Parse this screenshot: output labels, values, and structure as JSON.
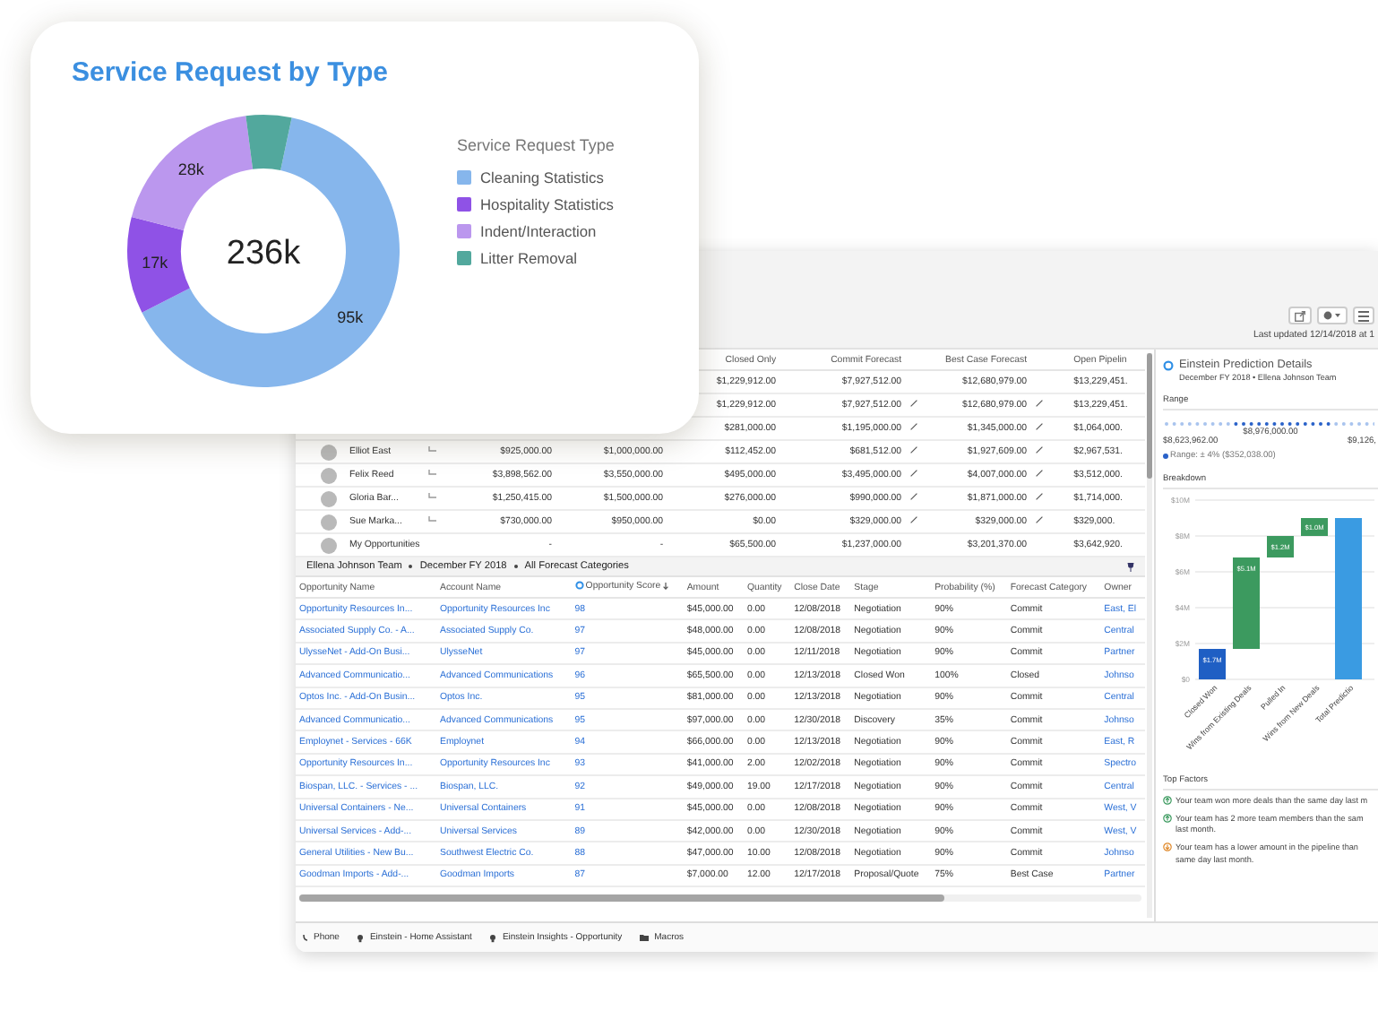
{
  "card": {
    "title": "Service Request by Type",
    "center_label": "236k",
    "chart_data": {
      "type": "donut",
      "categories": [
        "Cleaning Statistics",
        "Hospitality Statistics",
        "Indent/Interaction",
        "Litter Removal"
      ],
      "colors": [
        "#86b6ec",
        "#8f52e6",
        "#bb97ee",
        "#52a89d"
      ],
      "legend_title": "Service Request Type",
      "series": [
        {
          "values": [
            64.2,
            11.5,
            18.9,
            5.4
          ]
        }
      ],
      "value_labels": [
        "95k",
        "17k",
        "28k",
        null
      ]
    }
  },
  "app": {
    "last_updated": "Last updated 12/14/2018 at 1",
    "forecast_table": {
      "columns": [
        "Closed Only",
        "Commit Forecast",
        "Best Case Forecast",
        "Open Pipelin"
      ],
      "rows": [
        {
          "editable": false,
          "closed": "$1,229,912.00",
          "commit": "$7,927,512.00",
          "best": "$12,680,979.00",
          "open": "$13,229,451."
        },
        {
          "editable": true,
          "closed": "$1,229,912.00",
          "commit": "$7,927,512.00",
          "best": "$12,680,979.00",
          "open": "$13,229,451."
        },
        {
          "editable": true,
          "closed": "$281,000.00",
          "commit": "$1,195,000.00",
          "best": "$1,345,000.00",
          "open": "$1,064,000."
        },
        {
          "kind": "member",
          "name": "Elliot East",
          "amount_1": "$925,000.00",
          "amount_2": "$1,000,000.00",
          "editable": true,
          "closed": "$112,452.00",
          "commit": "$681,512.00",
          "best": "$1,927,609.00",
          "open": "$2,967,531."
        },
        {
          "kind": "member",
          "name": "Felix Reed",
          "amount_1": "$3,898,562.00",
          "amount_2": "$3,550,000.00",
          "editable": true,
          "closed": "$495,000.00",
          "commit": "$3,495,000.00",
          "best": "$4,007,000.00",
          "open": "$3,512,000."
        },
        {
          "kind": "member",
          "name": "Gloria Bar...",
          "amount_1": "$1,250,415.00",
          "amount_2": "$1,500,000.00",
          "editable": true,
          "closed": "$276,000.00",
          "commit": "$990,000.00",
          "best": "$1,871,000.00",
          "open": "$1,714,000."
        },
        {
          "kind": "member",
          "name": "Sue Marka...",
          "amount_1": "$730,000.00",
          "amount_2": "$950,000.00",
          "editable": true,
          "closed": "$0.00",
          "commit": "$329,000.00",
          "best": "$329,000.00",
          "open": "$329,000."
        },
        {
          "kind": "self",
          "name": "My Opportunities",
          "amount_1": "-",
          "amount_2": "-",
          "editable": false,
          "closed": "$65,500.00",
          "commit": "$1,237,000.00",
          "best": "$3,201,370.00",
          "open": "$3,642,920."
        }
      ]
    },
    "opportunities": {
      "breadcrumb": [
        "Ellena Johnson Team",
        "December FY 2018",
        "All Forecast Categories"
      ],
      "columns": [
        {
          "label": "Opportunity Name",
          "sorted": false
        },
        {
          "label": "Account Name",
          "sorted": false
        },
        {
          "label": "Opportunity Score",
          "sorted": true
        },
        {
          "label": "Amount",
          "sorted": false
        },
        {
          "label": "Quantity",
          "sorted": false
        },
        {
          "label": "Close Date",
          "sorted": false
        },
        {
          "label": "Stage",
          "sorted": false
        },
        {
          "label": "Probability (%)",
          "sorted": false
        },
        {
          "label": "Forecast Category",
          "sorted": false
        },
        {
          "label": "Owner",
          "sorted": false
        }
      ],
      "rows": [
        [
          "Opportunity Resources In...",
          "Opportunity Resources Inc",
          "98",
          "$45,000.00",
          "0.00",
          "12/08/2018",
          "Negotiation",
          "90%",
          "Commit",
          "East, El"
        ],
        [
          "Associated Supply Co. - A...",
          "Associated Supply Co.",
          "97",
          "$48,000.00",
          "0.00",
          "12/08/2018",
          "Negotiation",
          "90%",
          "Commit",
          "Central"
        ],
        [
          "UlysseNet - Add-On Busi...",
          "UlysseNet",
          "97",
          "$45,000.00",
          "0.00",
          "12/11/2018",
          "Negotiation",
          "90%",
          "Commit",
          "Partner"
        ],
        [
          "Advanced Communicatio...",
          "Advanced Communications",
          "96",
          "$65,500.00",
          "0.00",
          "12/13/2018",
          "Closed Won",
          "100%",
          "Closed",
          "Johnso"
        ],
        [
          "Optos Inc. - Add-On Busin...",
          "Optos Inc.",
          "95",
          "$81,000.00",
          "0.00",
          "12/13/2018",
          "Negotiation",
          "90%",
          "Commit",
          "Central"
        ],
        [
          "Advanced Communicatio...",
          "Advanced Communications",
          "95",
          "$97,000.00",
          "0.00",
          "12/30/2018",
          "Discovery",
          "35%",
          "Commit",
          "Johnso"
        ],
        [
          "Employnet - Services - 66K",
          "Employnet",
          "94",
          "$66,000.00",
          "0.00",
          "12/13/2018",
          "Negotiation",
          "90%",
          "Commit",
          "East, R"
        ],
        [
          "Opportunity Resources In...",
          "Opportunity Resources Inc",
          "93",
          "$41,000.00",
          "2.00",
          "12/02/2018",
          "Negotiation",
          "90%",
          "Commit",
          "Spectro"
        ],
        [
          "Biospan, LLC. - Services - ...",
          "Biospan, LLC.",
          "92",
          "$49,000.00",
          "19.00",
          "12/17/2018",
          "Negotiation",
          "90%",
          "Commit",
          "Central"
        ],
        [
          "Universal Containers - Ne...",
          "Universal Containers",
          "91",
          "$45,000.00",
          "0.00",
          "12/08/2018",
          "Negotiation",
          "90%",
          "Commit",
          "West, V"
        ],
        [
          "Universal Services - Add-...",
          "Universal Services",
          "89",
          "$42,000.00",
          "0.00",
          "12/30/2018",
          "Negotiation",
          "90%",
          "Commit",
          "West, V"
        ],
        [
          "General Utilities - New Bu...",
          "Southwest Electric Co.",
          "88",
          "$47,000.00",
          "10.00",
          "12/08/2018",
          "Negotiation",
          "90%",
          "Commit",
          "Johnso"
        ],
        [
          "Goodman Imports - Add-...",
          "Goodman Imports",
          "87",
          "$7,000.00",
          "12.00",
          "12/17/2018",
          "Proposal/Quote",
          "75%",
          "Best Case",
          "Partner"
        ]
      ]
    },
    "prediction": {
      "title": "Einstein Prediction Details",
      "subtitle": "December FY 2018 • Ellena Johnson Team",
      "range_label": "Range",
      "predicted": "$8,976,000.00",
      "range_low": "$8,623,962.00",
      "range_high": "$9,126,",
      "range_note": "Range: ± 4% ($352,038.00)",
      "breakdown_label": "Breakdown",
      "chart_data": {
        "type": "candlestick",
        "grid": true,
        "categories": [
          "Closed Won",
          "Wins from Existing Deals",
          "Pulled In",
          "Wins from New Deals",
          "Total Predictio"
        ],
        "colors": [
          "#1f5fc4",
          "#3c9a5f",
          "#3c9a5f",
          "#3c9a5f",
          "#3a9be2"
        ],
        "ohlc": [
          [
            0,
            1.7,
            0,
            1.7
          ],
          [
            1.7,
            6.8,
            1.7,
            6.8
          ],
          [
            6.8,
            8.0,
            6.8,
            8.0
          ],
          [
            8.0,
            9.0,
            8.0,
            9.0
          ],
          [
            0,
            9.0,
            0,
            9.0
          ]
        ],
        "ylim": [
          0,
          10
        ],
        "yticks": [
          {
            "value": 0,
            "label": "$0"
          },
          {
            "value": 2,
            "label": "$2M"
          },
          {
            "value": 4,
            "label": "$4M"
          },
          {
            "value": 6,
            "label": "$6M"
          },
          {
            "value": 8,
            "label": "$8M"
          },
          {
            "value": 10,
            "label": "$10M"
          }
        ],
        "value_labels": [
          "$1.7M",
          "$5.1M",
          "$1.2M",
          "$1.0M",
          null
        ]
      },
      "factors_label": "Top Factors",
      "factors": [
        {
          "kind": "positive",
          "lines": [
            "Your team won more deals than the same day last m"
          ]
        },
        {
          "kind": "positive",
          "lines": [
            "Your team has 2 more team members than the sam",
            "last month."
          ]
        },
        {
          "kind": "negative",
          "lines": [
            "Your team has a lower amount in the pipeline than",
            "same day last month."
          ]
        }
      ]
    },
    "utility_bar": [
      {
        "kind": "phone",
        "label": "Phone"
      },
      {
        "kind": "einstein",
        "label": "Einstein - Home Assistant"
      },
      {
        "kind": "einstein",
        "label": "Einstein Insights - Opportunity"
      },
      {
        "kind": "macros",
        "label": "Macros"
      }
    ]
  }
}
